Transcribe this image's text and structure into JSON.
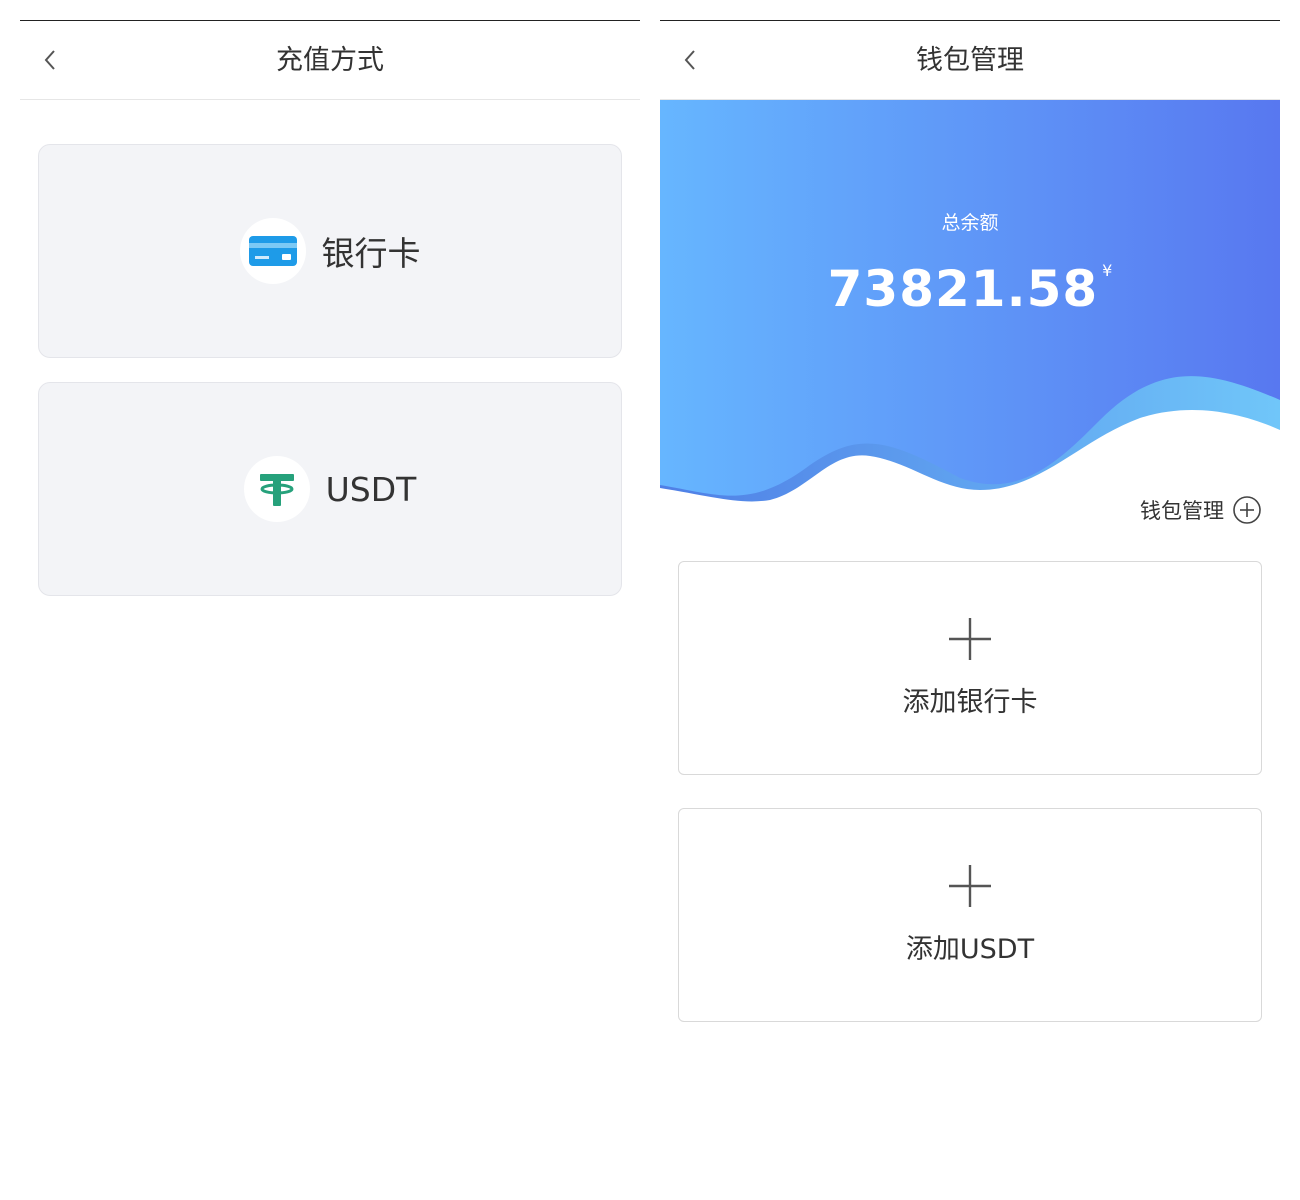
{
  "left_screen": {
    "nav": {
      "back_icon": "chevron-left-icon",
      "title": "充值方式"
    },
    "methods": [
      {
        "icon": "bank-card-icon",
        "label": "银行卡"
      },
      {
        "icon": "tether-icon",
        "label": "USDT"
      }
    ]
  },
  "right_screen": {
    "nav": {
      "back_icon": "chevron-left-icon",
      "title": "钱包管理"
    },
    "wallet": {
      "balance_label": "总余额",
      "balance_amount": "73821.58",
      "currency_symbol": "¥",
      "gradient_start": "#66b6ff",
      "gradient_end": "#5878f0"
    },
    "manage": {
      "label": "钱包管理",
      "icon": "plus-circle-icon"
    },
    "add_items": [
      {
        "icon": "plus-icon",
        "label": "添加银行卡"
      },
      {
        "icon": "plus-icon",
        "label": "添加USDT"
      }
    ]
  }
}
